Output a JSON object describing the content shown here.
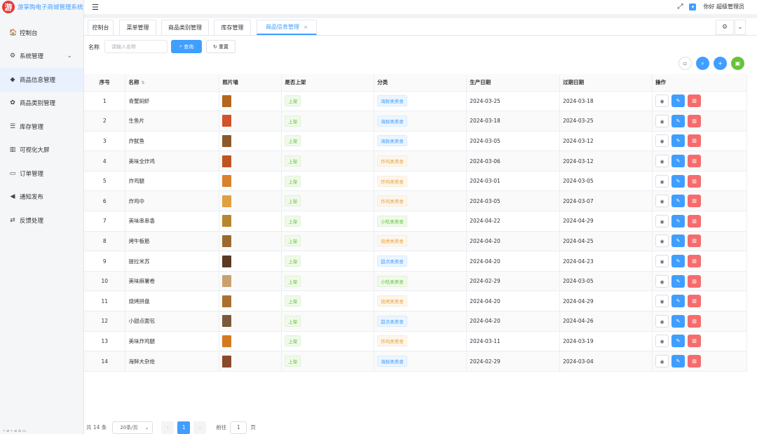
{
  "app": {
    "logo_char": "游",
    "title": "游享购电子商城管理系统"
  },
  "header": {
    "greeting": "你好 超级管理员"
  },
  "sidebar": {
    "items": [
      {
        "icon": "🏠",
        "label": "控制台"
      },
      {
        "icon": "⚙",
        "label": "系统管理"
      },
      {
        "icon": "◆",
        "label": "商品信息管理"
      },
      {
        "icon": "✿",
        "label": "商品类别管理"
      },
      {
        "icon": "☰",
        "label": "库存管理"
      },
      {
        "icon": "▥",
        "label": "可视化大屏"
      },
      {
        "icon": "▭",
        "label": "订单管理"
      },
      {
        "icon": "◀",
        "label": "通知发布"
      },
      {
        "icon": "⇄",
        "label": "反馈处理"
      }
    ],
    "active_index": 2,
    "bottom_text": "⌁ ⌀ ⌁ ⌀ ⌂ ▭"
  },
  "tabs": [
    {
      "label": "控制台"
    },
    {
      "label": "菜单管理"
    },
    {
      "label": "商品类别管理"
    },
    {
      "label": "库存管理"
    },
    {
      "label": "商品信息管理",
      "active": true,
      "close": "×"
    }
  ],
  "search": {
    "label": "名称",
    "placeholder": "请输入名称",
    "query_label": "查询",
    "reset_label": "重置"
  },
  "table": {
    "headers": [
      "序号",
      "名称",
      "照片墙",
      "是否上架",
      "分类",
      "生产日期",
      "过期日期",
      "操作"
    ],
    "rows": [
      {
        "no": "1",
        "name": "青蟹焖虾",
        "status": "上架",
        "category": "海鲜类美食",
        "cat_color": "blue",
        "made": "2024-03-25",
        "expire": "2024-03-18",
        "thumb": "#b5651d"
      },
      {
        "no": "2",
        "name": "生鱼片",
        "status": "上架",
        "category": "海鲜类美食",
        "cat_color": "blue",
        "made": "2024-03-18",
        "expire": "2024-03-25",
        "thumb": "#d2522a"
      },
      {
        "no": "3",
        "name": "炸鱿鱼",
        "status": "上架",
        "category": "海鲜类美食",
        "cat_color": "blue",
        "made": "2024-03-05",
        "expire": "2024-03-12",
        "thumb": "#8a5a2b"
      },
      {
        "no": "4",
        "name": "美味全炸鸡",
        "status": "上架",
        "category": "炸鸡类美食",
        "cat_color": "orange",
        "made": "2024-03-06",
        "expire": "2024-03-12",
        "thumb": "#c0541e"
      },
      {
        "no": "5",
        "name": "炸鸡腿",
        "status": "上架",
        "category": "炸鸡类美食",
        "cat_color": "orange",
        "made": "2024-03-01",
        "expire": "2024-03-05",
        "thumb": "#d9822b"
      },
      {
        "no": "6",
        "name": "炸鸡中",
        "status": "上架",
        "category": "炸鸡类美食",
        "cat_color": "orange",
        "made": "2024-03-05",
        "expire": "2024-03-07",
        "thumb": "#e0a040"
      },
      {
        "no": "7",
        "name": "美味串串香",
        "status": "上架",
        "category": "小吃类美食",
        "cat_color": "green",
        "made": "2024-04-22",
        "expire": "2024-04-29",
        "thumb": "#b8862e"
      },
      {
        "no": "8",
        "name": "烤牛板筋",
        "status": "上架",
        "category": "烧烤类美食",
        "cat_color": "orange",
        "made": "2024-04-20",
        "expire": "2024-04-25",
        "thumb": "#9c6a30"
      },
      {
        "no": "9",
        "name": "提拉米苏",
        "status": "上架",
        "category": "甜点类美食",
        "cat_color": "blue",
        "made": "2024-04-20",
        "expire": "2024-04-23",
        "thumb": "#5a3a22"
      },
      {
        "no": "10",
        "name": "美味麻薯卷",
        "status": "上架",
        "category": "小吃类美食",
        "cat_color": "green",
        "made": "2024-02-29",
        "expire": "2024-03-05",
        "thumb": "#caa070"
      },
      {
        "no": "11",
        "name": "烧烤拼盘",
        "status": "上架",
        "category": "烧烤类美食",
        "cat_color": "orange",
        "made": "2024-04-20",
        "expire": "2024-04-29",
        "thumb": "#a9702f"
      },
      {
        "no": "12",
        "name": "小甜点面包",
        "status": "上架",
        "category": "甜点类美食",
        "cat_color": "blue",
        "made": "2024-04-20",
        "expire": "2024-04-26",
        "thumb": "#7a5a3a"
      },
      {
        "no": "13",
        "name": "美味炸鸡腿",
        "status": "上架",
        "category": "炸鸡类美食",
        "cat_color": "orange",
        "made": "2024-03-11",
        "expire": "2024-03-19",
        "thumb": "#d47a1e"
      },
      {
        "no": "14",
        "name": "海鲜大杂烩",
        "status": "上架",
        "category": "海鲜类美食",
        "cat_color": "blue",
        "made": "2024-02-29",
        "expire": "2024-03-04",
        "thumb": "#8b4a2a"
      }
    ]
  },
  "pagination": {
    "total": "共 14 条",
    "page_size": "20条/页",
    "current_page": "1",
    "goto_label": "前往",
    "goto_value": "1",
    "page_unit": "页"
  },
  "colors": {
    "primary": "#409eff",
    "success": "#67c23a",
    "danger": "#f56c6c",
    "warning": "#e6a23c"
  }
}
